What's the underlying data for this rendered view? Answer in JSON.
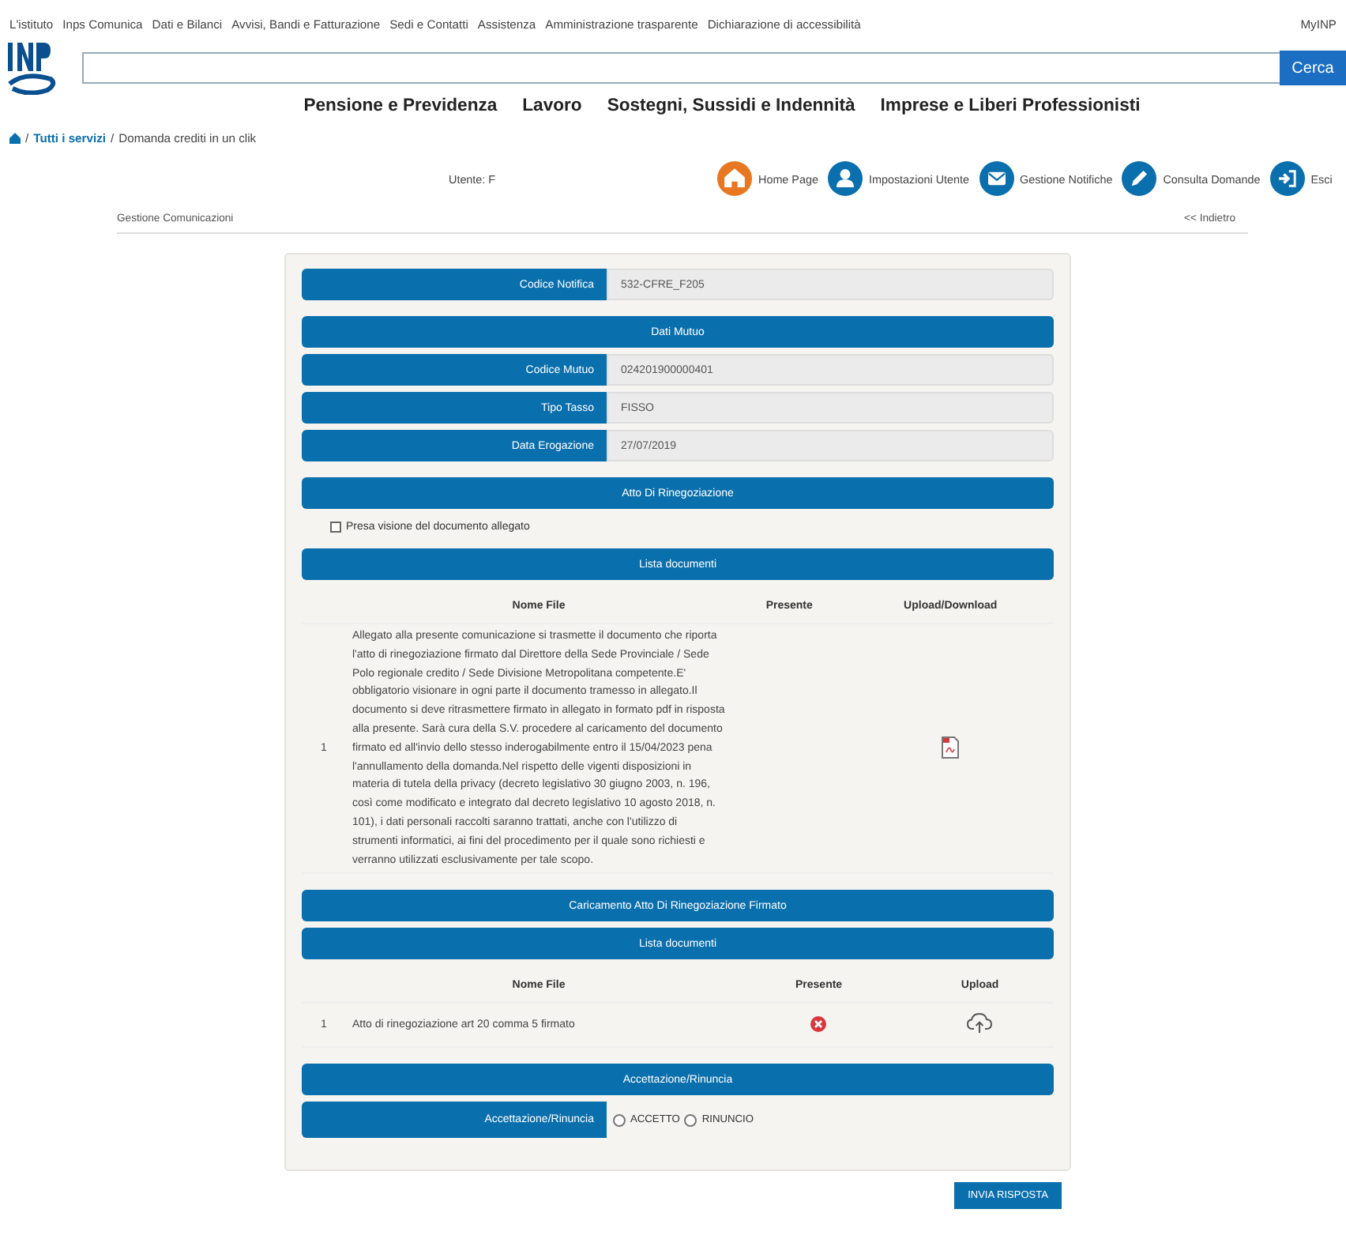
{
  "top_nav": [
    "L'istituto",
    "Inps Comunica",
    "Dati e Bilanci",
    "Avvisi, Bandi e Fatturazione",
    "Sedi e Contatti",
    "Assistenza",
    "Amministrazione trasparente",
    "Dichiarazione di accessibilità"
  ],
  "top_nav_right": "MyINP",
  "search": {
    "button": "Cerca"
  },
  "main_nav": [
    "Pensione e Previdenza",
    "Lavoro",
    "Sostegni, Sussidi e Indennità",
    "Imprese e Liberi Professionisti"
  ],
  "breadcrumb": [
    {
      "separator": "/",
      "label": "Tutti i servizi",
      "link": true
    },
    {
      "separator": "/",
      "label": "Domanda crediti in un clik",
      "link": false
    }
  ],
  "user": "Utente: F",
  "user_actions": [
    {
      "label": "Home Page",
      "kind": "home",
      "color": "#e87722"
    },
    {
      "label": "Impostazioni Utente",
      "kind": "user",
      "color": "#0a6fad"
    },
    {
      "label": "Gestione Notifiche",
      "kind": "mail",
      "color": "#0a6fad"
    },
    {
      "label": "Consulta Domande",
      "kind": "edit",
      "color": "#0a6fad"
    },
    {
      "label": "Esci",
      "kind": "exit",
      "color": "#0a6fad"
    }
  ],
  "section_title": "Gestione Comunicazioni",
  "back_link": "<< Indietro",
  "form": {
    "items": [
      {
        "kind": "field",
        "label": "Codice Notifica",
        "value": "532-CFRE_F205"
      },
      {
        "kind": "header",
        "title": "Dati Mutuo"
      },
      {
        "kind": "field",
        "label": "Codice Mutuo",
        "value": "024201900000401"
      },
      {
        "kind": "field",
        "label": "Tipo Tasso",
        "value": "FISSO"
      },
      {
        "kind": "field",
        "label": "Data Erogazione",
        "value": "27/07/2019"
      },
      {
        "kind": "header",
        "title": "Atto Di Rinegoziazione"
      },
      {
        "kind": "checkbox",
        "label": "Presa visione del documento allegato",
        "checked": false
      },
      {
        "kind": "header",
        "title": "Lista documenti"
      },
      {
        "kind": "table",
        "columns": [
          "Nome File",
          "Presente",
          "Upload/Download"
        ],
        "rows": [
          {
            "index": "1",
            "text": "Allegato alla presente comunicazione si trasmette il documento che riporta l'atto di rinegoziazione firmato dal Direttore della Sede Provinciale / Sede Polo regionale credito / Sede Divisione Metropolitana competente.E' obbligatorio visionare in ogni parte il documento tramesso in allegato.Il documento si deve ritrasmettere firmato in allegato in formato pdf in risposta alla presente. Sarà cura della S.V. procedere al caricamento del documento firmato ed all'invio dello stesso inderogabilmente entro il 15/04/2023 pena l'annullamento della domanda.Nel rispetto delle vigenti disposizioni in materia di tutela della privacy (decreto legislativo 30 giugno 2003, n. 196, così come modificato e integrato dal decreto legislativo 10 agosto 2018, n. 101), i dati personali raccolti saranno trattati, anche con l'utilizzo di strumenti informatici, ai fini del procedimento per il quale sono richiesti e verranno utilizzati esclusivamente per tale scopo.",
            "kind": "reference"
          }
        ]
      },
      {
        "kind": "header",
        "title": "Caricamento Atto Di Rinegoziazione Firmato"
      },
      {
        "kind": "header",
        "title": "Lista documenti"
      },
      {
        "kind": "table",
        "columns": [
          "Nome File",
          "Presente",
          "Upload"
        ],
        "rows": [
          {
            "index": "1",
            "text": "Atto di rinegoziazione art 20 comma 5 firmato",
            "kind": "upload"
          }
        ]
      },
      {
        "kind": "header",
        "title": "Accettazione/Rinuncia"
      },
      {
        "kind": "radio",
        "label": "Accettazione/Rinuncia",
        "options": [
          {
            "label": "ACCETTO",
            "selected": false
          },
          {
            "label": "RINUNCIO",
            "selected": false
          }
        ]
      }
    ]
  },
  "submit": "INVIA RISPOSTA"
}
